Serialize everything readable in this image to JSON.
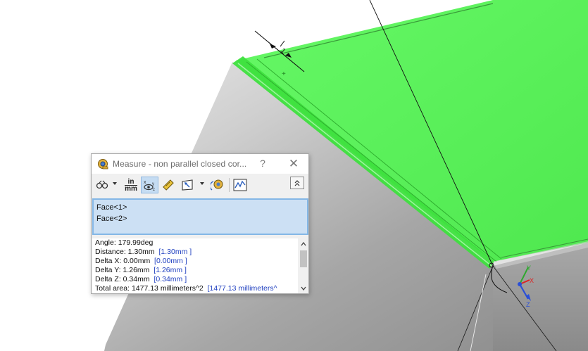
{
  "dialog": {
    "title": "Measure - non parallel closed cor...",
    "help_glyph": "?",
    "close_glyph": "✕",
    "toolbar": {
      "icons": [
        "arc-circle-measure-icon",
        "units-precision-icon",
        "show-xyz-measurements-icon",
        "point-to-point-icon",
        "projection-icon",
        "measurement-history-icon",
        "create-sensor-icon"
      ],
      "units_top": "in",
      "units_bottom": "mm"
    },
    "selections": [
      "Face<1>",
      "Face<2>"
    ],
    "results": [
      {
        "label": "Angle: 179.99deg",
        "alt": ""
      },
      {
        "label": "Distance: 1.30mm",
        "alt": "[1.30mm ]"
      },
      {
        "label": "Delta X: 0.00mm",
        "alt": "[0.00mm ]"
      },
      {
        "label": "Delta Y: 1.26mm",
        "alt": "[1.26mm ]"
      },
      {
        "label": "Delta Z: 0.34mm",
        "alt": "[0.34mm ]"
      },
      {
        "label": "Total area: 1477.13 millimeters^2",
        "alt": "[1477.13 millimeters^"
      }
    ]
  },
  "model": {
    "dimension_label": "1",
    "triad": {
      "x": "X",
      "y": "Y",
      "z": "Z"
    },
    "colors": {
      "face_green": "#55ee55",
      "body_gray": "#9c9c9c",
      "highlight_edge": "#33dd33"
    }
  }
}
